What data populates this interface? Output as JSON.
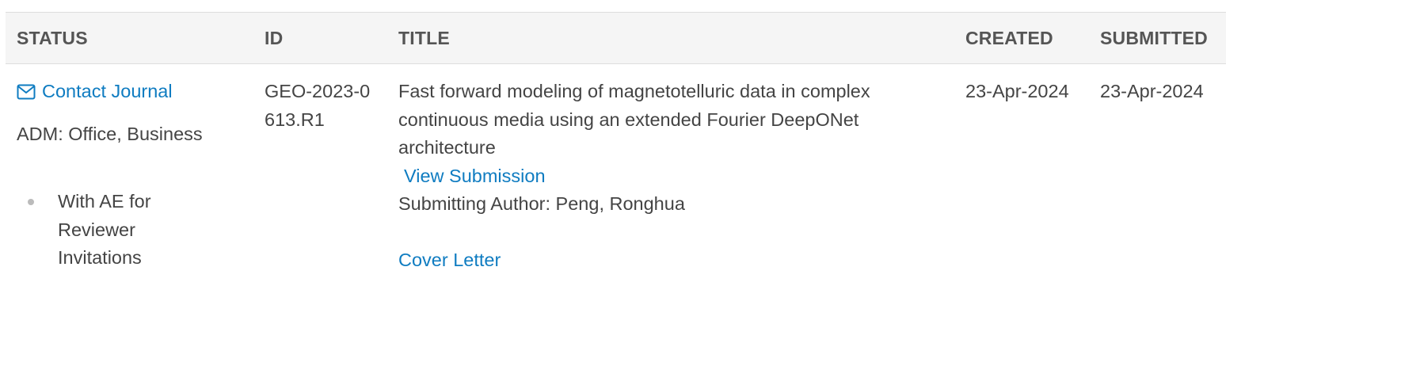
{
  "table": {
    "headers": {
      "status": "STATUS",
      "id": "ID",
      "title": "TITLE",
      "created": "CREATED",
      "submitted": "SUBMITTED"
    },
    "rows": [
      {
        "contact_label": "Contact Journal",
        "adm_text": "ADM: Office, Business",
        "status_item": "With AE for Reviewer Invitations",
        "id": "GEO-2023-0613.R1",
        "title": "Fast forward modeling of magnetotelluric data in complex continuous media using an extended Fourier DeepONet architecture",
        "view_label": "View Submission",
        "author_text": "Submitting Author: Peng, Ronghua",
        "cover_label": "Cover Letter",
        "created": "23-Apr-2024",
        "submitted": "23-Apr-2024"
      }
    ]
  },
  "icons": {
    "contact": "envelope-icon",
    "status_bullet": "bullet-dot"
  },
  "colors": {
    "link": "#0f7cc1",
    "text": "#444444",
    "header_text": "#555555",
    "header_bg": "#f5f5f5",
    "border": "#dddddd"
  }
}
